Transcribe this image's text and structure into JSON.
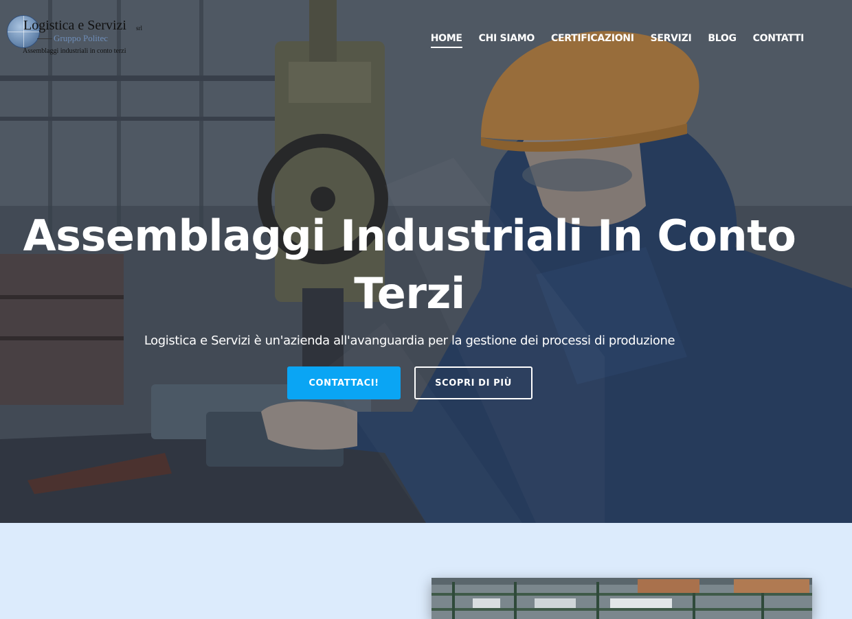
{
  "header": {
    "logo": {
      "name": "Logistica e Servizi",
      "suffix": "srl",
      "group": "Gruppo Politec",
      "tagline": "Assemblaggi industriali in conto terzi"
    },
    "nav": [
      {
        "label": "HOME",
        "active": true
      },
      {
        "label": "CHI SIAMO",
        "active": false
      },
      {
        "label": "CERTIFICAZIONI",
        "active": false
      },
      {
        "label": "SERVIZI",
        "active": false
      },
      {
        "label": "BLOG",
        "active": false
      },
      {
        "label": "CONTATTI",
        "active": false
      }
    ]
  },
  "hero": {
    "title": "Assemblaggi Industriali In Conto Terzi",
    "subtitle": "Logistica e Servizi è un'azienda all'avanguardia per la gestione dei processi di produzione",
    "primary_button": "CONTATTACI!",
    "secondary_button": "SCOPRI DI PIÙ"
  },
  "colors": {
    "accent": "#0aa5f4",
    "section_bg": "#dcebfc",
    "text_light": "#ffffff"
  }
}
